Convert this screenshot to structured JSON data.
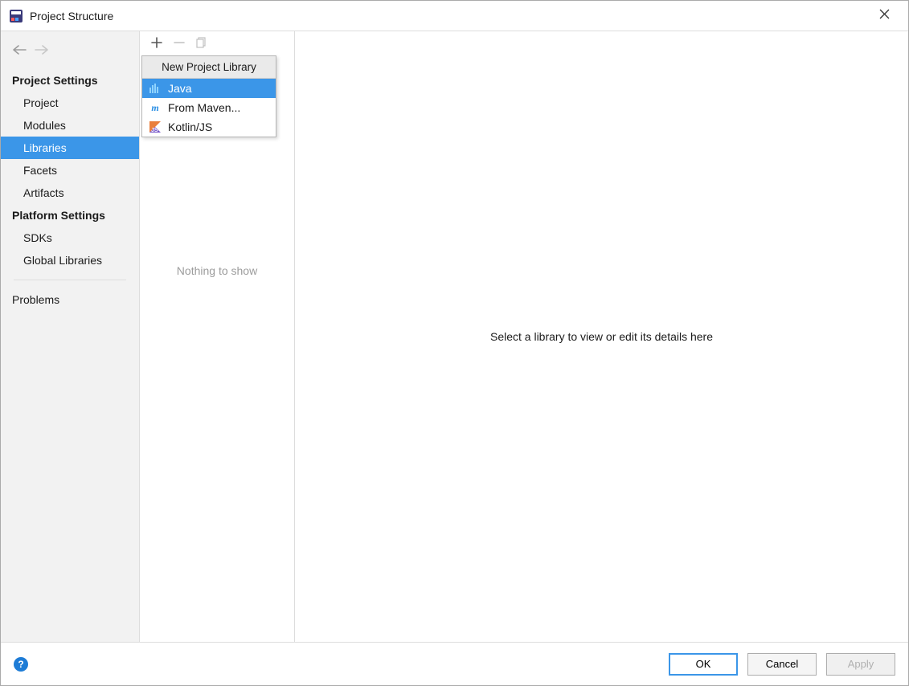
{
  "window": {
    "title": "Project Structure"
  },
  "sidebar": {
    "section1_header": "Project Settings",
    "section1_items": [
      "Project",
      "Modules",
      "Libraries",
      "Facets",
      "Artifacts"
    ],
    "section1_selected_index": 2,
    "section2_header": "Platform Settings",
    "section2_items": [
      "SDKs",
      "Global Libraries"
    ],
    "section3_items": [
      "Problems"
    ]
  },
  "midpanel": {
    "empty_message": "Nothing to show"
  },
  "popup": {
    "header": "New Project Library",
    "items": [
      {
        "label": "Java",
        "icon": "java-bars-icon"
      },
      {
        "label": "From Maven...",
        "icon": "maven-m-icon"
      },
      {
        "label": "Kotlin/JS",
        "icon": "kotlin-icon"
      }
    ],
    "selected_index": 0
  },
  "detail": {
    "placeholder": "Select a library to view or edit its details here"
  },
  "footer": {
    "ok_label": "OK",
    "cancel_label": "Cancel",
    "apply_label": "Apply"
  }
}
